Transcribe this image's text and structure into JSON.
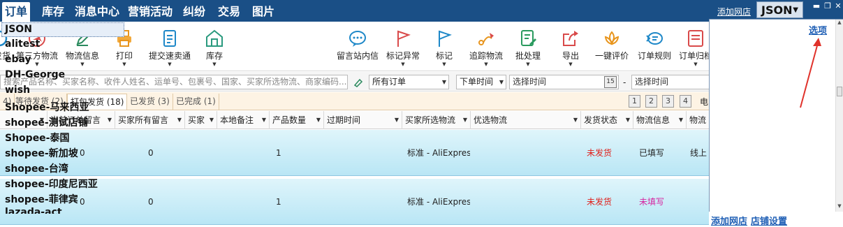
{
  "nav": {
    "tabs": [
      "订单",
      "库存",
      "消息中心",
      "营销活动",
      "纠纷",
      "交易",
      "图片"
    ],
    "add_shop": "添加网店",
    "shop_selected": "JSON"
  },
  "toolbar": {
    "left": [
      {
        "label": "发货",
        "icon": "ship-icon"
      },
      {
        "label": "第三方物流",
        "icon": "plane-icon"
      },
      {
        "label": "物流信息",
        "icon": "pencil-icon"
      },
      {
        "label": "打印",
        "icon": "printer-icon"
      },
      {
        "label": "提交速卖通",
        "icon": "document-icon"
      },
      {
        "label": "库存",
        "icon": "warehouse-icon"
      }
    ],
    "right": [
      {
        "label": "留言站内信",
        "icon": "chat-icon"
      },
      {
        "label": "标记异常",
        "icon": "red-flag-icon"
      },
      {
        "label": "标记",
        "icon": "blue-flag-icon"
      },
      {
        "label": "追踪物流",
        "icon": "tracking-icon"
      },
      {
        "label": "批处理",
        "icon": "batch-icon"
      },
      {
        "label": "导出",
        "icon": "export-icon"
      },
      {
        "label": "一键评价",
        "icon": "lotus-icon"
      },
      {
        "label": "订单规则",
        "icon": "rules-icon"
      },
      {
        "label": "订单归档",
        "icon": "archive-icon"
      }
    ]
  },
  "filter": {
    "search_placeholder": "搜索产品名称、买家名称、收件人姓名、运单号、包裹号、国家、买家所选物流、商家编码...",
    "order_scope": "所有订单",
    "time_type": "下单时间",
    "start_placeholder": "选择时间",
    "dash": "-",
    "end_placeholder": "选择时间",
    "calendar_day": "15"
  },
  "status_tabs": [
    {
      "label": "4)"
    },
    {
      "label": "等待发货 (2)"
    },
    {
      "label": "打包发货 (18)"
    },
    {
      "label": "已发货 (3)"
    },
    {
      "label": "已完成 (1)"
    }
  ],
  "pages": [
    "1",
    "2",
    "3",
    "4"
  ],
  "page_more": "电",
  "columns": [
    "当前订单留言",
    "买家所有留言",
    "买家",
    "本地备注",
    "产品数量",
    "过期时间",
    "买家所选物流",
    "优选物流",
    "发货状态",
    "物流信息",
    "物流"
  ],
  "rows": [
    {
      "order_msg": "0",
      "buyer_msgs": "0",
      "qty": "1",
      "logistics": "标准 - AliExpres",
      "ship_status": "未发货",
      "logistics_info": "已填写",
      "extra": "线上"
    },
    {
      "order_msg": "0",
      "buyer_msgs": "0",
      "qty": "1",
      "logistics": "标准 - AliExpres",
      "ship_status": "未发货",
      "logistics_info": "未填写",
      "extra": ""
    }
  ],
  "shop_dropdown": {
    "options_link": "选项",
    "items": [
      "JSON",
      "alitest",
      "ebay",
      "DH-George",
      "wish",
      "Shopee-马来西亚",
      "shopee-测试店铺",
      "Shopee-泰国",
      "shopee-新加坡",
      "shopee-台湾",
      "shopee-印度尼西亚",
      "shopee-菲律宾",
      "lazada-act"
    ],
    "footer_add": "添加网店",
    "footer_settings": "店铺设置"
  },
  "colors": {
    "nav_bg": "#1a4f86",
    "red_status": "#e0201b",
    "pink_status": "#d6249f",
    "link": "#1f5fb5",
    "annotation_arrow": "#e0322b"
  }
}
